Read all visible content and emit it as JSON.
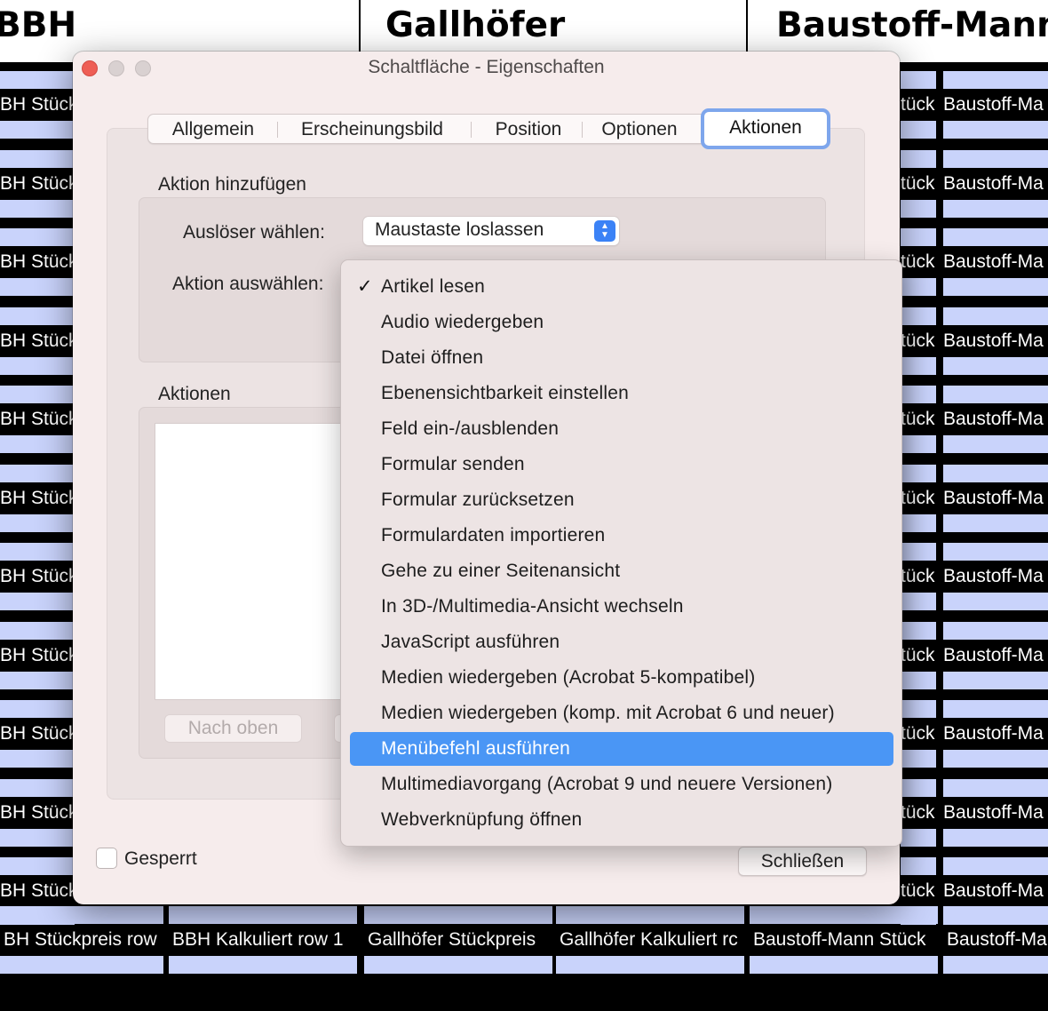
{
  "background": {
    "headers": [
      "BBH",
      "Gallhöfer",
      "Baustoff-Mann"
    ],
    "left_cell_label": "BH Stück",
    "right_col1_label": "tück",
    "right_col2_label": "Baustoff-Ma",
    "bottom_row": [
      "BH Stückpreis row",
      "BBH Kalkuliert row 1",
      "Gallhöfer Stückpreis",
      "Gallhöfer Kalkuliert rc",
      "Baustoff-Mann Stück",
      "Baustoff-Ma"
    ],
    "cell_fill_color": "#c9d3fb"
  },
  "dialog": {
    "title": "Schaltfläche - Eigenschaften",
    "tabs": [
      {
        "label": "Allgemein"
      },
      {
        "label": "Erscheinungsbild"
      },
      {
        "label": "Position"
      },
      {
        "label": "Optionen"
      },
      {
        "label": "Aktionen"
      }
    ],
    "active_tab": "Aktionen",
    "add_action": {
      "heading": "Aktion hinzufügen",
      "trigger_label": "Auslöser wählen:",
      "trigger_value": "Maustaste loslassen",
      "action_label": "Aktion auswählen:"
    },
    "actions": {
      "heading": "Aktionen",
      "move_up_label": "Nach oben"
    },
    "locked_label": "Gesperrt",
    "locked_checked": false,
    "close_label": "Schließen",
    "accent_color": "#4a96f5"
  },
  "menu": {
    "items": [
      {
        "label": "Artikel lesen",
        "checked": true
      },
      {
        "label": "Audio wiedergeben"
      },
      {
        "label": "Datei öffnen"
      },
      {
        "label": "Ebenensichtbarkeit einstellen"
      },
      {
        "label": "Feld ein-/ausblenden"
      },
      {
        "label": "Formular senden"
      },
      {
        "label": "Formular zurücksetzen"
      },
      {
        "label": "Formulardaten importieren"
      },
      {
        "label": "Gehe zu einer Seitenansicht"
      },
      {
        "label": "In 3D-/Multimedia-Ansicht wechseln"
      },
      {
        "label": "JavaScript ausführen"
      },
      {
        "label": "Medien wiedergeben (Acrobat 5-kompatibel)"
      },
      {
        "label": "Medien wiedergeben (komp. mit Acrobat 6 und neuer)"
      },
      {
        "label": "Menübefehl ausführen",
        "highlighted": true
      },
      {
        "label": "Multimediavorgang (Acrobat 9 und neuere Versionen)"
      },
      {
        "label": "Webverknüpfung öffnen"
      }
    ]
  }
}
